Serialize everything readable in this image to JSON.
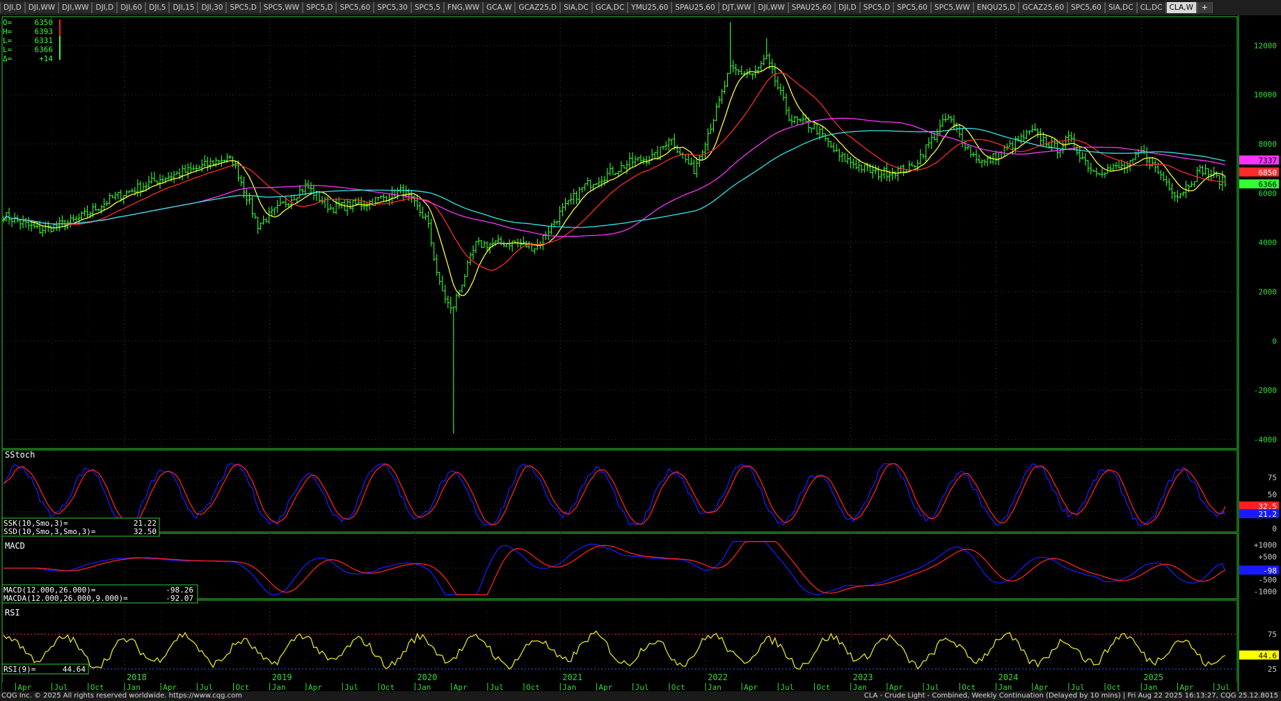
{
  "tabs": [
    "DJI,D",
    "DJI,WW",
    "DJI,WW",
    "DJI,D",
    "DJI,60",
    "DJI,5",
    "DJI,15",
    "DJI,30",
    "SPC5,D",
    "SPC5,WW",
    "SPC5,D",
    "SPC5,60",
    "SPC5,30",
    "SPC5,5",
    "FNG,WW",
    "GCA,W",
    "GCAZ25,D",
    "SIA,DC",
    "GCA,DC",
    "YMU25,60",
    "SPAU25,60",
    "DJT,WW",
    "DJI,WW",
    "SPAU25,60",
    "DJI,D",
    "SPC5,D",
    "SPC5,60",
    "SPC5,WW",
    "ENQU25,D",
    "GCAZ25,60",
    "SPC5,60",
    "SIA,DC",
    "CL,DC",
    "CLA,W"
  ],
  "active_tab": "CLA,W",
  "add_tab": "+",
  "ohlc": [
    {
      "label": "O=",
      "value": "6350"
    },
    {
      "label": "H=",
      "value": "6393"
    },
    {
      "label": "L=",
      "value": "6331"
    },
    {
      "label": "L=",
      "value": "6366"
    },
    {
      "label": "Δ=",
      "value": "+14"
    }
  ],
  "footer": {
    "left": "CQG Inc. © 2025 All rights reserved worldwide. https://www.cqg.com",
    "right": "CLA - Crude Light - Combined, Weekly Continuation (Delayed by 10 mins) | Fri Aug 22 2025 16:13:27, CQG 25.12.8015"
  },
  "colors": {
    "price": "#33ff33",
    "ma_fast": "#ffff33",
    "ma_mid": "#ff2a2a",
    "ma_slow": "#ff33ff",
    "ma_long": "#33e6e6",
    "ssk": "#1a1aff",
    "ssd": "#ff2020",
    "rsi": "#e6e61a",
    "axis": "#33dd33",
    "grid": "#3a3a3a"
  },
  "chart_data": [
    {
      "type": "candlestick",
      "x_start": "2017-03",
      "x_end": "2025-08",
      "ylim": [
        -4000,
        13000
      ],
      "yticks": [
        12000,
        10000,
        8000,
        6000,
        4000,
        2000,
        0,
        -2000,
        -4000
      ],
      "anchors": [
        [
          "2017-03",
          5100
        ],
        [
          "2017-06",
          4500
        ],
        [
          "2017-09",
          4900
        ],
        [
          "2017-12",
          5800
        ],
        [
          "2018-04",
          6600
        ],
        [
          "2018-07",
          7000
        ],
        [
          "2018-09",
          7400
        ],
        [
          "2018-10",
          7300
        ],
        [
          "2018-12",
          4700
        ],
        [
          "2019-04",
          6300
        ],
        [
          "2019-06",
          5400
        ],
        [
          "2019-09",
          5600
        ],
        [
          "2019-12",
          6100
        ],
        [
          "2020-02",
          4900
        ],
        [
          "2020-03",
          2300
        ],
        [
          "2020-04",
          1200
        ],
        [
          "2020-06",
          3900
        ],
        [
          "2020-09",
          4000
        ],
        [
          "2020-11",
          3800
        ],
        [
          "2021-01",
          5200
        ],
        [
          "2021-03",
          6300
        ],
        [
          "2021-07",
          7300
        ],
        [
          "2021-09",
          7500
        ],
        [
          "2021-10",
          8300
        ],
        [
          "2021-12",
          6900
        ],
        [
          "2022-02",
          9500
        ],
        [
          "2022-03",
          11000
        ],
        [
          "2022-05",
          10800
        ],
        [
          "2022-06",
          11500
        ],
        [
          "2022-08",
          9000
        ],
        [
          "2022-10",
          8700
        ],
        [
          "2022-12",
          7500
        ],
        [
          "2023-03",
          6800
        ],
        [
          "2023-06",
          7000
        ],
        [
          "2023-09",
          9100
        ],
        [
          "2023-11",
          7600
        ],
        [
          "2023-12",
          7200
        ],
        [
          "2024-04",
          8500
        ],
        [
          "2024-06",
          7800
        ],
        [
          "2024-07",
          8200
        ],
        [
          "2024-09",
          6900
        ],
        [
          "2024-12",
          7100
        ],
        [
          "2025-01",
          7700
        ],
        [
          "2025-04",
          5900
        ],
        [
          "2025-06",
          7000
        ],
        [
          "2025-08",
          6366
        ]
      ],
      "spikes": [
        {
          "date": "2020-04",
          "low": -3760
        },
        {
          "date": "2022-03",
          "high": 12950
        },
        {
          "date": "2022-06",
          "high": 12300
        }
      ],
      "overlays": [
        {
          "name": "fast_ma",
          "color_key": "ma_fast"
        },
        {
          "name": "mid_ma",
          "color_key": "ma_mid"
        },
        {
          "name": "slow_ma",
          "color_key": "ma_slow"
        },
        {
          "name": "long_ma",
          "color_key": "ma_long"
        }
      ],
      "last_labels": [
        {
          "value": "7337",
          "bg": "#ff33ff",
          "fg": "#000000"
        },
        {
          "value": "6850",
          "bg": "#ff2a2a",
          "fg": "#ffffff"
        },
        {
          "value": "6366",
          "bg": "#33ff33",
          "fg": "#000000"
        }
      ]
    },
    {
      "type": "line",
      "title": "SStoch",
      "ylim": [
        0,
        100
      ],
      "yticks": [
        75,
        50,
        25,
        0
      ],
      "series": [
        {
          "name": "SSK(10,Smo,3)=",
          "value": "21.22",
          "color_key": "ssk"
        },
        {
          "name": "SSD(10,Smo,3,Smo,3)=",
          "value": "32.50",
          "color_key": "ssd"
        }
      ],
      "last_labels": [
        {
          "value": "32.5",
          "bg": "#ff2020",
          "fg": "#ffffff"
        },
        {
          "value": "21.2",
          "bg": "#1a1aff",
          "fg": "#ffffff"
        }
      ]
    },
    {
      "type": "line",
      "title": "MACD",
      "ylim": [
        -1200,
        1200
      ],
      "yticks": [
        "+1000",
        "+500",
        "-500",
        "-1000"
      ],
      "series": [
        {
          "name": "MACD(12.000,26.000)=",
          "value": "-98.26",
          "color_key": "ssk"
        },
        {
          "name": "MACDA(12.000,26.000,9.000)=",
          "value": "-92.07",
          "color_key": "ssd"
        }
      ],
      "last_labels": [
        {
          "value": "-98",
          "bg": "#1a1aff",
          "fg": "#ffffff"
        }
      ]
    },
    {
      "type": "line",
      "title": "RSI",
      "ylim": [
        10,
        95
      ],
      "yticks": [
        75,
        25
      ],
      "overbought": 75,
      "oversold": 25,
      "series": [
        {
          "name": "RSI(9)=",
          "value": "44.64",
          "color_key": "rsi"
        }
      ],
      "last_labels": [
        {
          "value": "44.6",
          "bg": "#ffff00",
          "fg": "#000000"
        }
      ]
    }
  ],
  "x_axis": {
    "years": [
      {
        "date": "2018-01",
        "label": "2018"
      },
      {
        "date": "2019-01",
        "label": "2019"
      },
      {
        "date": "2020-01",
        "label": "2020"
      },
      {
        "date": "2021-01",
        "label": "2021"
      },
      {
        "date": "2022-01",
        "label": "2022"
      },
      {
        "date": "2023-01",
        "label": "2023"
      },
      {
        "date": "2024-01",
        "label": "2024"
      },
      {
        "date": "2025-01",
        "label": "2025"
      }
    ],
    "months": [
      [
        "2017-04",
        "Apr"
      ],
      [
        "2017-07",
        "Jul"
      ],
      [
        "2017-10",
        "Oct"
      ],
      [
        "2018-01",
        "Jan"
      ],
      [
        "2018-04",
        "Apr"
      ],
      [
        "2018-07",
        "Jul"
      ],
      [
        "2018-10",
        "Oct"
      ],
      [
        "2019-01",
        "Jan"
      ],
      [
        "2019-04",
        "Apr"
      ],
      [
        "2019-07",
        "Jul"
      ],
      [
        "2019-10",
        "Oct"
      ],
      [
        "2020-01",
        "Jan"
      ],
      [
        "2020-04",
        "Apr"
      ],
      [
        "2020-07",
        "Jul"
      ],
      [
        "2020-10",
        "Oct"
      ],
      [
        "2021-01",
        "Jan"
      ],
      [
        "2021-04",
        "Apr"
      ],
      [
        "2021-07",
        "Jul"
      ],
      [
        "2021-10",
        "Oct"
      ],
      [
        "2022-01",
        "Jan"
      ],
      [
        "2022-04",
        "Apr"
      ],
      [
        "2022-07",
        "Jul"
      ],
      [
        "2022-10",
        "Oct"
      ],
      [
        "2023-01",
        "Jan"
      ],
      [
        "2023-04",
        "Apr"
      ],
      [
        "2023-07",
        "Jul"
      ],
      [
        "2023-10",
        "Oct"
      ],
      [
        "2024-01",
        "Jan"
      ],
      [
        "2024-04",
        "Apr"
      ],
      [
        "2024-07",
        "Jul"
      ],
      [
        "2024-10",
        "Oct"
      ],
      [
        "2025-01",
        "Jan"
      ],
      [
        "2025-04",
        "Apr"
      ],
      [
        "2025-07",
        "Jul"
      ]
    ]
  }
}
